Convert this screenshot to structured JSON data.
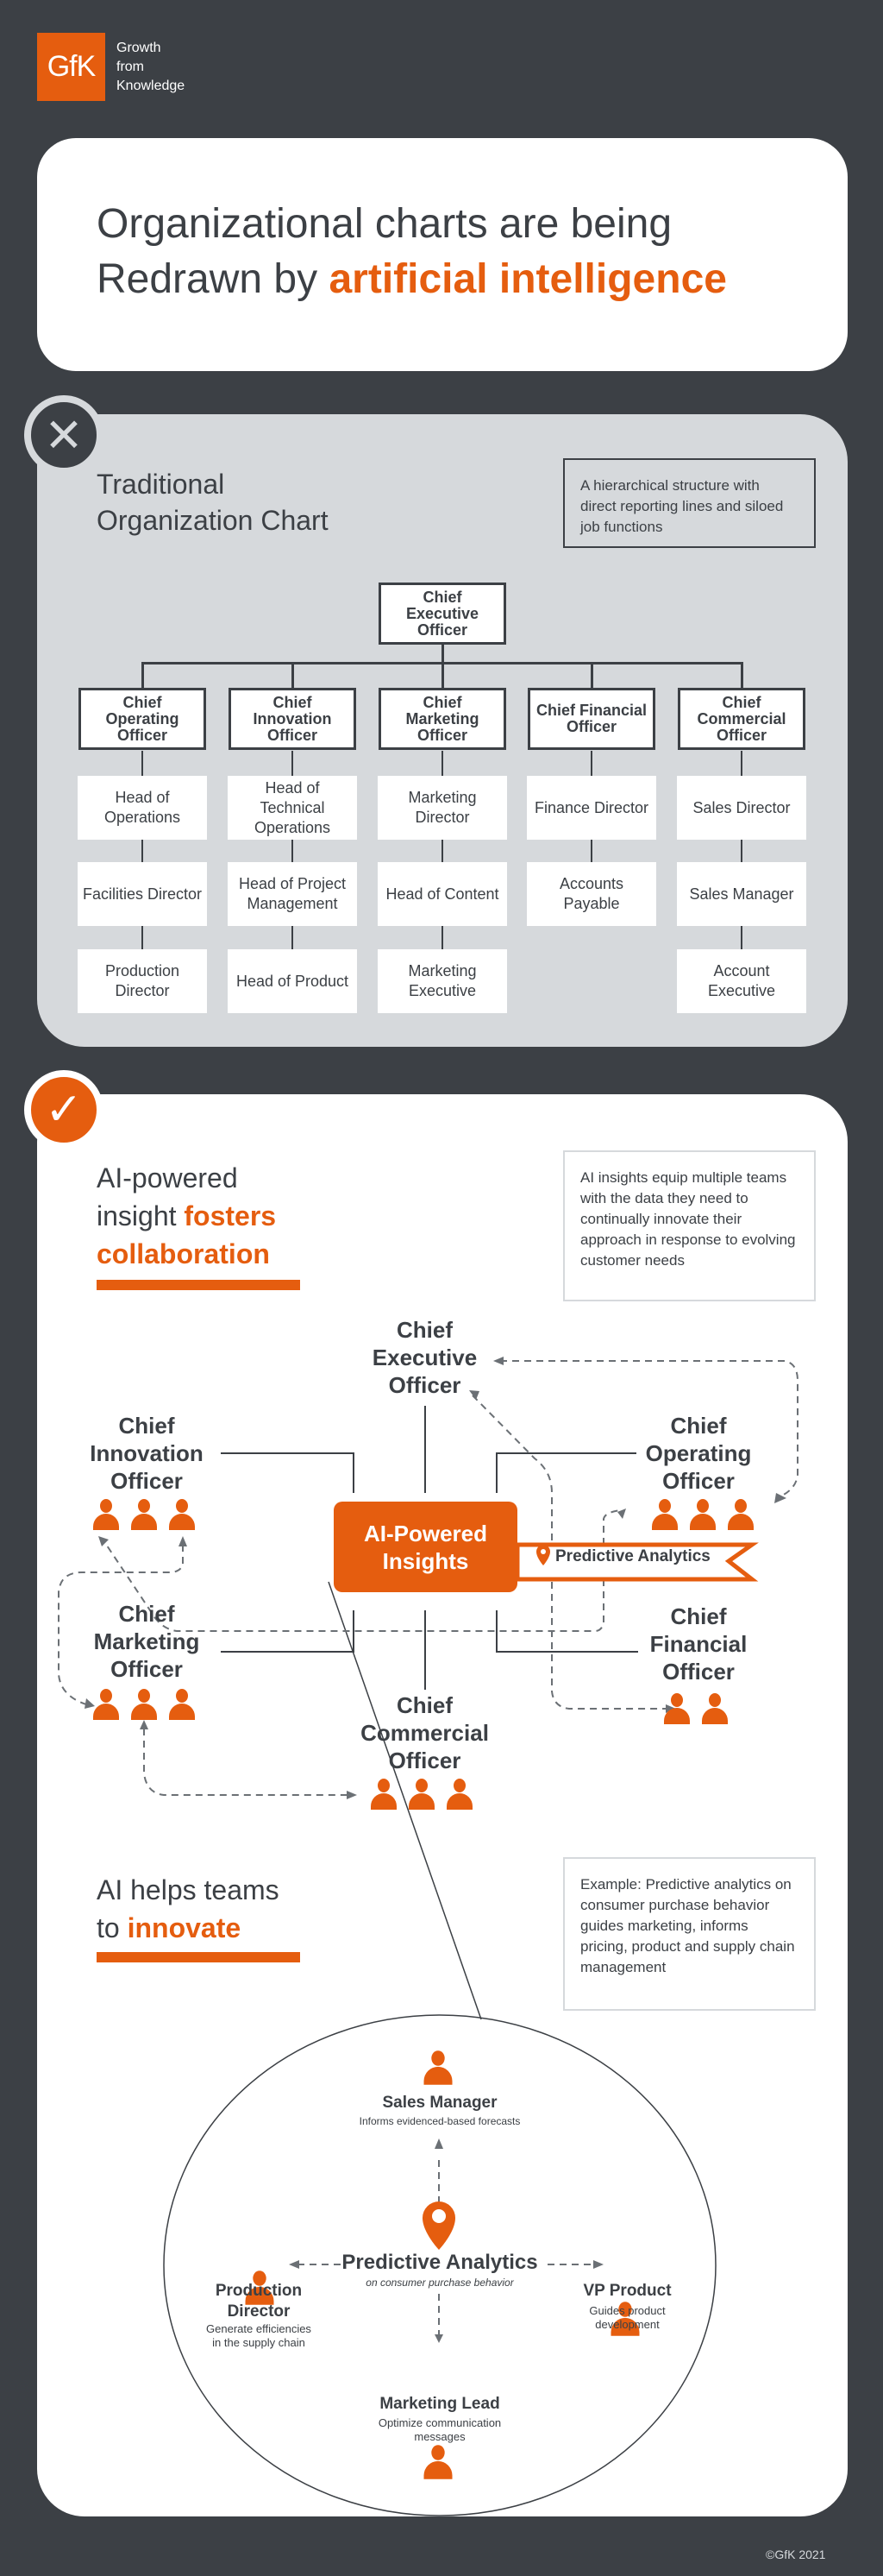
{
  "header": {
    "logo_text": "GfK",
    "tagline": [
      "Growth",
      "from",
      "Knowledge"
    ]
  },
  "title": {
    "line1": "Organizational charts are being",
    "line2_prefix": "Redrawn by ",
    "line2_highlight": "artificial intelligence"
  },
  "traditional": {
    "badge_icon": "close-icon",
    "title": [
      "Traditional",
      "Organization Chart"
    ],
    "note": "A hierarchical structure with direct reporting lines and siloed job functions",
    "ceo": "Chief Executive Officer",
    "columns": [
      {
        "chief": "Chief Operating Officer",
        "reports": [
          "Head of Operations",
          "Facilities Director",
          "Production Director"
        ]
      },
      {
        "chief": "Chief Innovation Officer",
        "reports": [
          "Head of Technical Operations",
          "Head of Project Management",
          "Head of Product"
        ]
      },
      {
        "chief": "Chief Marketing Officer",
        "reports": [
          "Marketing Director",
          "Head of Content",
          "Marketing Executive"
        ]
      },
      {
        "chief": "Chief Financial Officer",
        "reports": [
          "Finance Director",
          "Accounts Payable"
        ]
      },
      {
        "chief": "Chief Commercial Officer",
        "reports": [
          "Sales Director",
          "Sales Manager",
          "Account Executive"
        ]
      }
    ]
  },
  "ai_section": {
    "badge_icon": "check-icon",
    "title_line1": "AI-powered",
    "title_line2_prefix": "insight ",
    "title_line2_highlight": "fosters",
    "title_line3_highlight": "collaboration",
    "note": "AI insights equip multiple teams with the data they need to continually innovate their approach in response to evolving customer needs",
    "hub": "AI-Powered Insights",
    "hub_tag": "Predictive Analytics",
    "roles": {
      "ceo": "Chief Executive Officer",
      "cino": "Chief Innovation Officer",
      "coo": "Chief Operating Officer",
      "cmo": "Chief Marketing Officer",
      "cfo": "Chief Financial Officer",
      "cco": "Chief Commercial Officer"
    },
    "team_sizes": {
      "cino": 3,
      "coo": 3,
      "cmo": 3,
      "cfo": 2,
      "cco": 3
    }
  },
  "innovate_section": {
    "title_line1": "AI helps teams",
    "title_line2_prefix": "to ",
    "title_line2_highlight": "innovate",
    "note": "Example: Predictive analytics on consumer purchase behavior guides marketing, informs pricing, product and supply chain management",
    "center_title": "Predictive Analytics",
    "center_subtitle": "on consumer purchase behavior",
    "nodes": [
      {
        "role": "Sales Manager",
        "desc": "Informs evidenced-based forecasts"
      },
      {
        "role": "Production Director",
        "desc": "Generate efficiencies in the supply chain"
      },
      {
        "role": "VP Product",
        "desc": "Guides product development"
      },
      {
        "role": "Marketing Lead",
        "desc": "Optimize communication messages"
      }
    ]
  },
  "footer": {
    "copyright": "©GfK 2021"
  },
  "colors": {
    "accent": "#e55d0f",
    "dark": "#3c4045",
    "light_gray": "#d6d9dc",
    "white": "#ffffff"
  }
}
